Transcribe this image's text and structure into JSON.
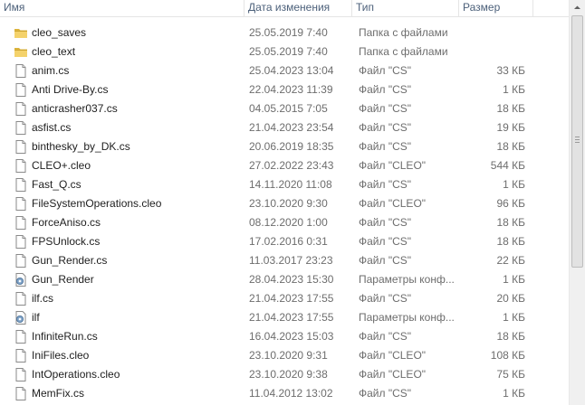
{
  "columns": {
    "name": "Имя",
    "date": "Дата изменения",
    "type": "Тип",
    "size": "Размер"
  },
  "files": [
    {
      "icon": "folder",
      "name": "cleo_saves",
      "date": "25.05.2019 7:40",
      "type": "Папка с файлами",
      "size": ""
    },
    {
      "icon": "folder",
      "name": "cleo_text",
      "date": "25.05.2019 7:40",
      "type": "Папка с файлами",
      "size": ""
    },
    {
      "icon": "file",
      "name": "anim.cs",
      "date": "25.04.2023 13:04",
      "type": "Файл \"CS\"",
      "size": "33 КБ"
    },
    {
      "icon": "file",
      "name": "Anti Drive-By.cs",
      "date": "22.04.2023 11:39",
      "type": "Файл \"CS\"",
      "size": "1 КБ"
    },
    {
      "icon": "file",
      "name": "anticrasher037.cs",
      "date": "04.05.2015 7:05",
      "type": "Файл \"CS\"",
      "size": "18 КБ"
    },
    {
      "icon": "file",
      "name": "asfist.cs",
      "date": "21.04.2023 23:54",
      "type": "Файл \"CS\"",
      "size": "19 КБ"
    },
    {
      "icon": "file",
      "name": "binthesky_by_DK.cs",
      "date": "20.06.2019 18:35",
      "type": "Файл \"CS\"",
      "size": "18 КБ"
    },
    {
      "icon": "file",
      "name": "CLEO+.cleo",
      "date": "27.02.2022 23:43",
      "type": "Файл \"CLEO\"",
      "size": "544 КБ"
    },
    {
      "icon": "file",
      "name": "Fast_Q.cs",
      "date": "14.11.2020 11:08",
      "type": "Файл \"CS\"",
      "size": "1 КБ"
    },
    {
      "icon": "file",
      "name": "FileSystemOperations.cleo",
      "date": "23.10.2020 9:30",
      "type": "Файл \"CLEO\"",
      "size": "96 КБ"
    },
    {
      "icon": "file",
      "name": "ForceAniso.cs",
      "date": "08.12.2020 1:00",
      "type": "Файл \"CS\"",
      "size": "18 КБ"
    },
    {
      "icon": "file",
      "name": "FPSUnlock.cs",
      "date": "17.02.2016 0:31",
      "type": "Файл \"CS\"",
      "size": "18 КБ"
    },
    {
      "icon": "file",
      "name": "Gun_Render.cs",
      "date": "11.03.2017 23:23",
      "type": "Файл \"CS\"",
      "size": "22 КБ"
    },
    {
      "icon": "settings-file",
      "name": "Gun_Render",
      "date": "28.04.2023 15:30",
      "type": "Параметры конф...",
      "size": "1 КБ"
    },
    {
      "icon": "file",
      "name": "ilf.cs",
      "date": "21.04.2023 17:55",
      "type": "Файл \"CS\"",
      "size": "20 КБ"
    },
    {
      "icon": "settings-file",
      "name": "ilf",
      "date": "21.04.2023 17:55",
      "type": "Параметры конф...",
      "size": "1 КБ"
    },
    {
      "icon": "file",
      "name": "InfiniteRun.cs",
      "date": "16.04.2023 15:03",
      "type": "Файл \"CS\"",
      "size": "18 КБ"
    },
    {
      "icon": "file",
      "name": "IniFiles.cleo",
      "date": "23.10.2020 9:31",
      "type": "Файл \"CLEO\"",
      "size": "108 КБ"
    },
    {
      "icon": "file",
      "name": "IntOperations.cleo",
      "date": "23.10.2020 9:38",
      "type": "Файл \"CLEO\"",
      "size": "75 КБ"
    },
    {
      "icon": "file",
      "name": "MemFix.cs",
      "date": "11.04.2012 13:02",
      "type": "Файл \"CS\"",
      "size": "1 КБ"
    }
  ]
}
